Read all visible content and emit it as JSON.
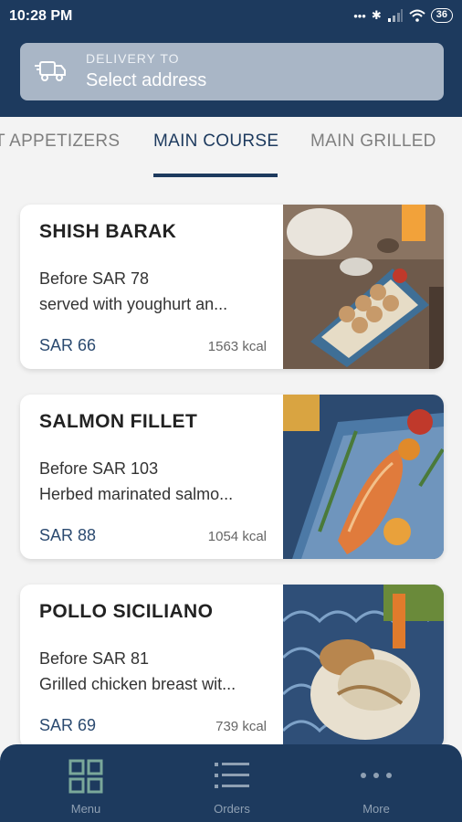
{
  "status_bar": {
    "time": "10:28 PM",
    "battery": "36"
  },
  "delivery": {
    "label": "DELIVERY TO",
    "value": "Select address"
  },
  "tabs": [
    {
      "label": "T APPETIZERS",
      "active": false
    },
    {
      "label": "MAIN COURSE",
      "active": true
    },
    {
      "label": "MAIN GRILLED",
      "active": false
    }
  ],
  "menu_items": [
    {
      "name": "SHISH BARAK",
      "before": "Before SAR 78",
      "description": "served with youghurt an...",
      "price": "SAR 66",
      "kcal": "1563 kcal"
    },
    {
      "name": "SALMON FILLET",
      "before": "Before SAR 103",
      "description": "Herbed marinated salmo...",
      "price": "SAR 88",
      "kcal": "1054 kcal"
    },
    {
      "name": "POLLO SICILIANO",
      "before": "Before SAR 81",
      "description": "Grilled chicken breast wit...",
      "price": "SAR 69",
      "kcal": "739 kcal"
    }
  ],
  "bottom_nav": [
    {
      "label": "Menu",
      "icon": "grid-icon",
      "active": true
    },
    {
      "label": "Orders",
      "icon": "list-icon",
      "active": false
    },
    {
      "label": "More",
      "icon": "more-dots-icon",
      "active": false
    }
  ],
  "colors": {
    "primary": "#1d3a5e",
    "delivery_bar": "#a9b6c6",
    "inactive_nav": "#8fa0b3",
    "active_nav_icon": "#7aa89a"
  }
}
